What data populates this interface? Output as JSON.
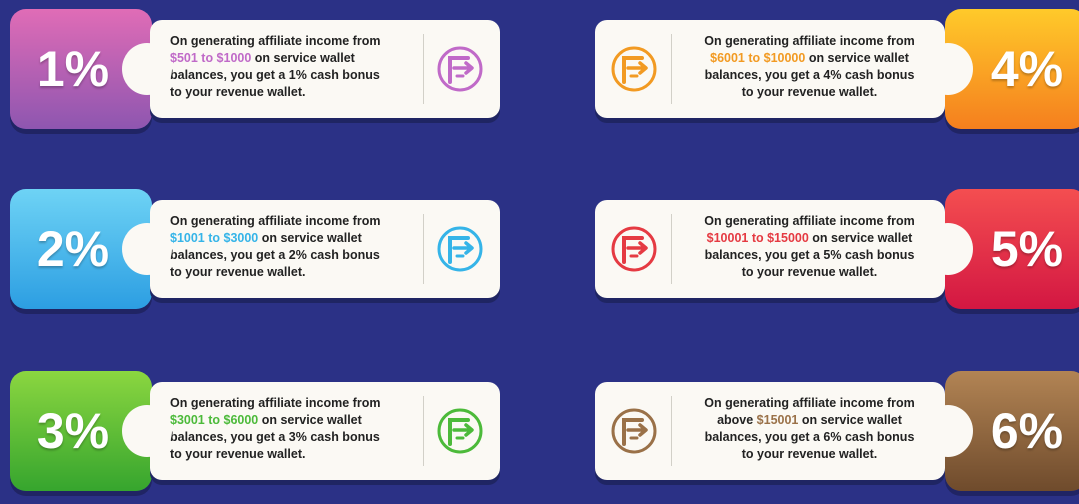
{
  "cards": [
    {
      "pct": "1%",
      "range": "$501 to $1000",
      "line1": "On generating affiliate income from",
      "after": " on service wallet",
      "line3a": "balances, you get a ",
      "bonus": "1%",
      "line3b": " cash bonus",
      "line4": "to your revenue wallet.",
      "colors": {
        "top": "#e06cb6",
        "bottom": "#8e56b0",
        "accent": "#c06ac8"
      }
    },
    {
      "pct": "2%",
      "range": "$1001 to $3000",
      "line1": "On generating affiliate income from",
      "after": " on service wallet",
      "line3a": "balances, you get a ",
      "bonus": "2%",
      "line3b": " cash bonus",
      "line4": "to your revenue wallet.",
      "colors": {
        "top": "#6ed3f5",
        "bottom": "#2c9ee2",
        "accent": "#35b4e8"
      }
    },
    {
      "pct": "3%",
      "range": "$3001 to $6000",
      "line1": "On generating affiliate income from",
      "after": " on service wallet",
      "line3a": "balances, you get a ",
      "bonus": "3%",
      "line3b": " cash bonus",
      "line4": "to your revenue wallet.",
      "colors": {
        "top": "#8bd640",
        "bottom": "#36a52e",
        "accent": "#4cba3a"
      }
    },
    {
      "pct": "4%",
      "range": "$6001 to $10000",
      "line1": "On generating affiliate income from",
      "after": " on service wallet",
      "line3a": "balances, you get a ",
      "bonus": "4%",
      "line3b": " cash bonus",
      "line4": "to your revenue wallet.",
      "colors": {
        "top": "#ffca2a",
        "bottom": "#f57f1e",
        "accent": "#f29a22"
      }
    },
    {
      "pct": "5%",
      "range": "$10001 to $15000",
      "line1": "On generating affiliate income from",
      "after": " on service wallet",
      "line3a": "balances, you get a ",
      "bonus": "5%",
      "line3b": " cash bonus",
      "line4": "to your revenue wallet.",
      "colors": {
        "top": "#f44e50",
        "bottom": "#d31742",
        "accent": "#e53a42"
      }
    },
    {
      "pct": "6%",
      "range": "$15001",
      "rangePrefix": "above ",
      "line1": "On generating affiliate income from",
      "after": " on service wallet",
      "line3a": "balances, you get a ",
      "bonus": "6%",
      "line3b": " cash bonus",
      "line4": "to your revenue wallet.",
      "colors": {
        "top": "#b28454",
        "bottom": "#6f4b2c",
        "accent": "#9a7148"
      }
    }
  ],
  "icons": {
    "logo": "f-arrow-logo-icon"
  }
}
